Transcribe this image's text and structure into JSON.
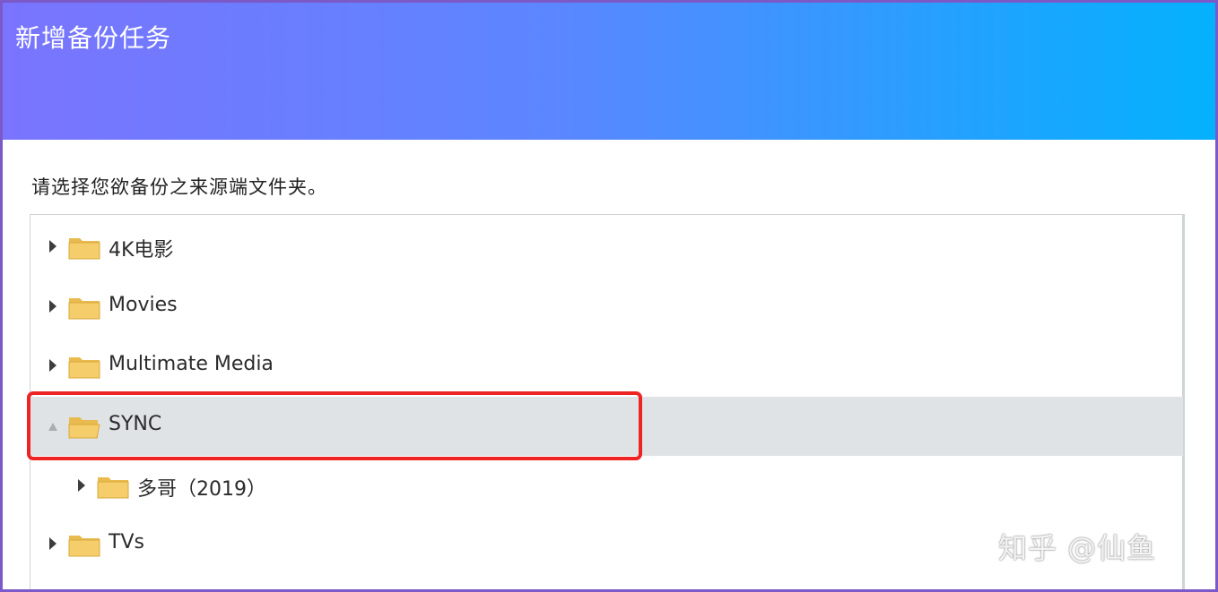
{
  "dialog": {
    "title": "新增备份任务",
    "prompt": "请选择您欲备份之来源端文件夹。"
  },
  "folder_tree": {
    "folder_icon_color": "#f5cd6a",
    "selected_bg": "#dfe3e6",
    "items": [
      {
        "label": "4K电影",
        "expanded": false,
        "selected": false
      },
      {
        "label": "Movies",
        "expanded": false,
        "selected": false
      },
      {
        "label": "Multimate Media",
        "expanded": false,
        "selected": false
      },
      {
        "label": "SYNC",
        "expanded": true,
        "selected": true
      },
      {
        "label": "多哥（2019）",
        "expanded": false,
        "selected": false
      },
      {
        "label": "TVs",
        "expanded": false,
        "selected": false
      }
    ]
  },
  "annotation": {
    "highlight_color": "#ee2323"
  },
  "watermark": {
    "text": "知乎 @仙鱼"
  }
}
